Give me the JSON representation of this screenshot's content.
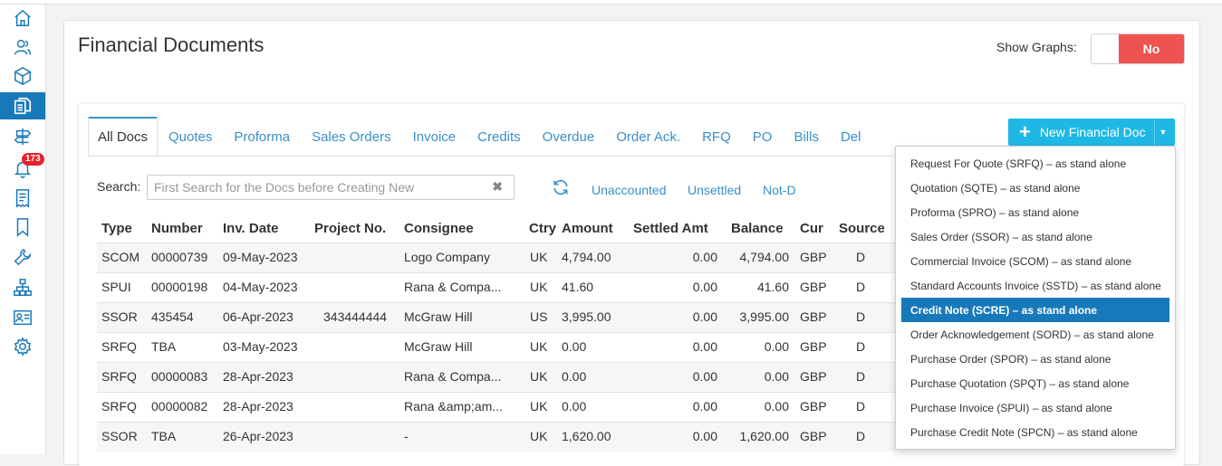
{
  "sidebar": {
    "icons": [
      "home-icon",
      "contacts-icon",
      "box-icon",
      "documents-icon",
      "signpost-icon",
      "bell-icon",
      "receipt-icon",
      "bookmark-icon",
      "wrench-icon",
      "sitemap-icon",
      "id-card-icon",
      "gear-icon"
    ],
    "notification_count": "173",
    "accent_color": "#1779ba"
  },
  "header": {
    "title": "Financial Documents",
    "show_graphs_label": "Show Graphs:",
    "show_graphs_value": "No"
  },
  "tabs": [
    "All Docs",
    "Quotes",
    "Proforma",
    "Sales Orders",
    "Invoice",
    "Credits",
    "Overdue",
    "Order Ack.",
    "RFQ",
    "PO",
    "Bills",
    "Del"
  ],
  "new_button": {
    "label": "New Financial Doc"
  },
  "search": {
    "label": "Search:",
    "placeholder": "First Search for the Docs before Creating New",
    "clear": "✖"
  },
  "filters": [
    "Unaccounted",
    "Unsettled",
    "Not-D"
  ],
  "table": {
    "headers": [
      "Type",
      "Number",
      "Inv. Date",
      "Project No.",
      "Consignee",
      "Ctry",
      "Amount",
      "Settled Amt",
      "Balance",
      "Cur",
      "Source"
    ],
    "rows": [
      [
        "SCOM",
        "00000739",
        "09-May-2023",
        "",
        "Logo Company",
        "UK",
        "4,794.00",
        "0.00",
        "4,794.00",
        "GBP",
        "D"
      ],
      [
        "SPUI",
        "00000198",
        "04-May-2023",
        "",
        "Rana & Compa...",
        "UK",
        "41.60",
        "0.00",
        "41.60",
        "GBP",
        "D"
      ],
      [
        "SSOR",
        "435454",
        "06-Apr-2023",
        "343444444",
        "McGraw Hill",
        "US",
        "3,995.00",
        "0.00",
        "3,995.00",
        "GBP",
        "D"
      ],
      [
        "SRFQ",
        "TBA",
        "03-May-2023",
        "",
        "McGraw Hill",
        "UK",
        "0.00",
        "0.00",
        "0.00",
        "GBP",
        "D"
      ],
      [
        "SRFQ",
        "00000083",
        "28-Apr-2023",
        "",
        "Rana & Compa...",
        "UK",
        "0.00",
        "0.00",
        "0.00",
        "GBP",
        "D"
      ],
      [
        "SRFQ",
        "00000082",
        "28-Apr-2023",
        "",
        "Rana &amp;am...",
        "UK",
        "0.00",
        "0.00",
        "0.00",
        "GBP",
        "D"
      ],
      [
        "SSOR",
        "TBA",
        "26-Apr-2023",
        "",
        "-",
        "UK",
        "1,620.00",
        "0.00",
        "1,620.00",
        "GBP",
        "D"
      ]
    ]
  },
  "dropdown": {
    "selected_index": 6,
    "items": [
      "Request For Quote (SRFQ) – as stand alone",
      "Quotation (SQTE) – as stand alone",
      "Proforma (SPRO) – as stand alone",
      "Sales Order (SSOR) – as stand alone",
      "Commercial Invoice (SCOM) – as stand alone",
      "Standard Accounts Invoice (SSTD) – as stand alone",
      "Credit Note (SCRE) – as stand alone",
      "Order Acknowledgement (SORD) – as stand alone",
      "Purchase Order (SPOR) – as stand alone",
      "Purchase Quotation (SPQT) – as stand alone",
      "Purchase Invoice (SPUI) – as stand alone",
      "Purchase Credit Note (SPCN) – as stand alone"
    ]
  }
}
